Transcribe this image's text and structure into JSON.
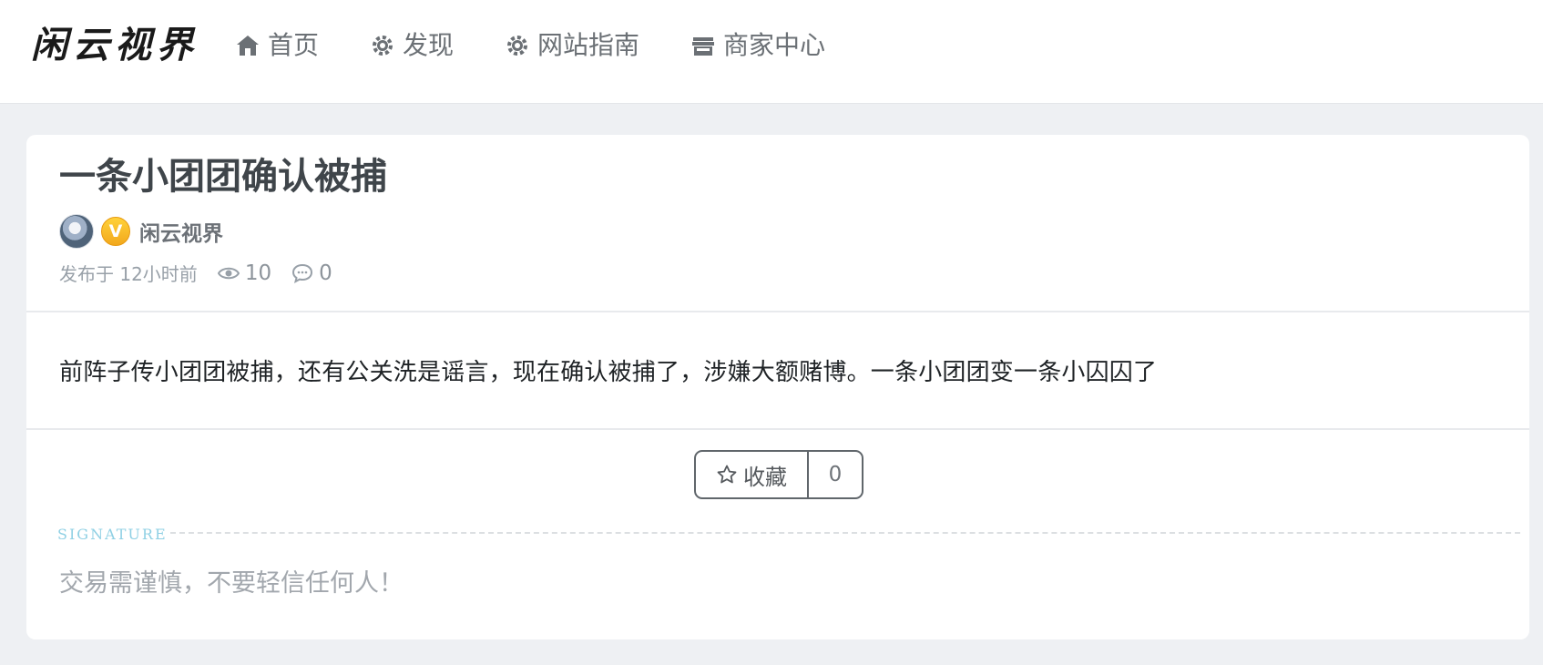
{
  "header": {
    "logo": "闲云视界",
    "nav": [
      {
        "label": "首页",
        "icon": "home-icon"
      },
      {
        "label": "发现",
        "icon": "gear-icon"
      },
      {
        "label": "网站指南",
        "icon": "gear-icon"
      },
      {
        "label": "商家中心",
        "icon": "store-icon"
      }
    ]
  },
  "post": {
    "title": "一条小团团确认被捕",
    "author": {
      "name": "闲云视界",
      "badge": "V"
    },
    "meta": {
      "published": "发布于 12小时前",
      "views": "10",
      "comments": "0"
    },
    "content": "前阵子传小团团被捕，还有公关洗是谣言，现在确认被捕了，涉嫌大额赌博。一条小团团变一条小囚囚了"
  },
  "favorite": {
    "label": "收藏",
    "count": "0"
  },
  "signature": {
    "label": "SIGNATURE",
    "text": "交易需谨慎，不要轻信任何人！"
  },
  "colors": {
    "accent": "#8fd0e4",
    "badge": "#f5b320",
    "text": "#3f454a"
  }
}
